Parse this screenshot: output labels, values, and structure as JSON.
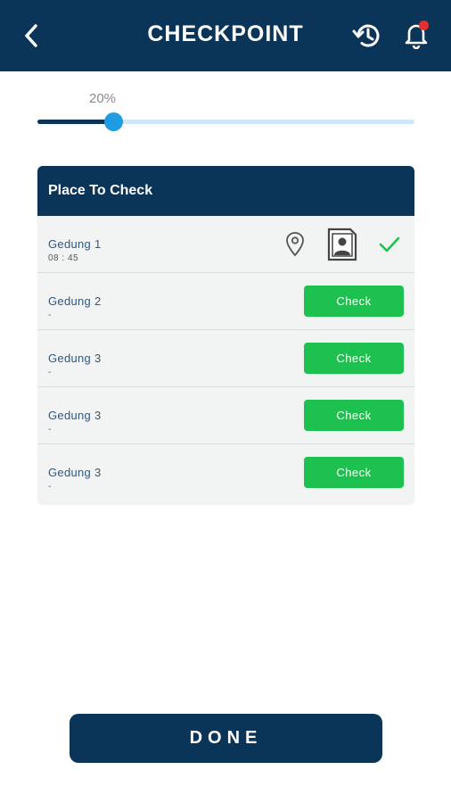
{
  "header": {
    "title": "CHECKPOINT",
    "back_icon": "chevron-left-icon",
    "history_icon": "history-icon",
    "notification_icon": "bell-icon",
    "notification_badge_color": "#e0312f",
    "background_color": "#0b3558"
  },
  "progress": {
    "label": "20%",
    "value_percent": 20
  },
  "places": {
    "title": "Place To Check",
    "items": [
      {
        "name": "Gedung 1",
        "time": "08 : 45",
        "status": "checked"
      },
      {
        "name": "Gedung 2",
        "time": "-",
        "action_label": "Check"
      },
      {
        "name": "Gedung 3",
        "time": "-",
        "action_label": "Check"
      },
      {
        "name": "Gedung 3",
        "time": "-",
        "action_label": "Check"
      },
      {
        "name": "Gedung 3",
        "time": "-",
        "action_label": "Check"
      }
    ]
  },
  "footer": {
    "done_label": "DONE"
  },
  "colors": {
    "primary": "#0b3558",
    "accent": "#1e9be3",
    "check_green": "#1ec04f"
  }
}
